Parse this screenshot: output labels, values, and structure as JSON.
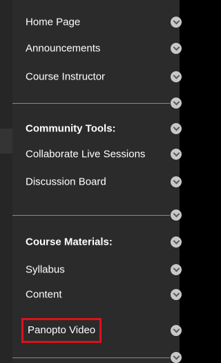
{
  "nav": {
    "items": [
      {
        "label": "Home Page"
      },
      {
        "label": "Announcements"
      },
      {
        "label": "Course Instructor"
      },
      {
        "label": "Community Tools:"
      },
      {
        "label": "Collaborate Live Sessions"
      },
      {
        "label": "Discussion Board"
      },
      {
        "label": "Course Materials:"
      },
      {
        "label": "Syllabus"
      },
      {
        "label": "Content"
      },
      {
        "label": "Panopto Video"
      }
    ]
  },
  "colors": {
    "background": "#2b2b2b",
    "text": "#ffffff",
    "divider": "#8a8a8a",
    "highlight_border": "#e0101a",
    "options_icon": "#c8c8c8"
  },
  "icons": {
    "item_options": "chevron-down-icon"
  }
}
